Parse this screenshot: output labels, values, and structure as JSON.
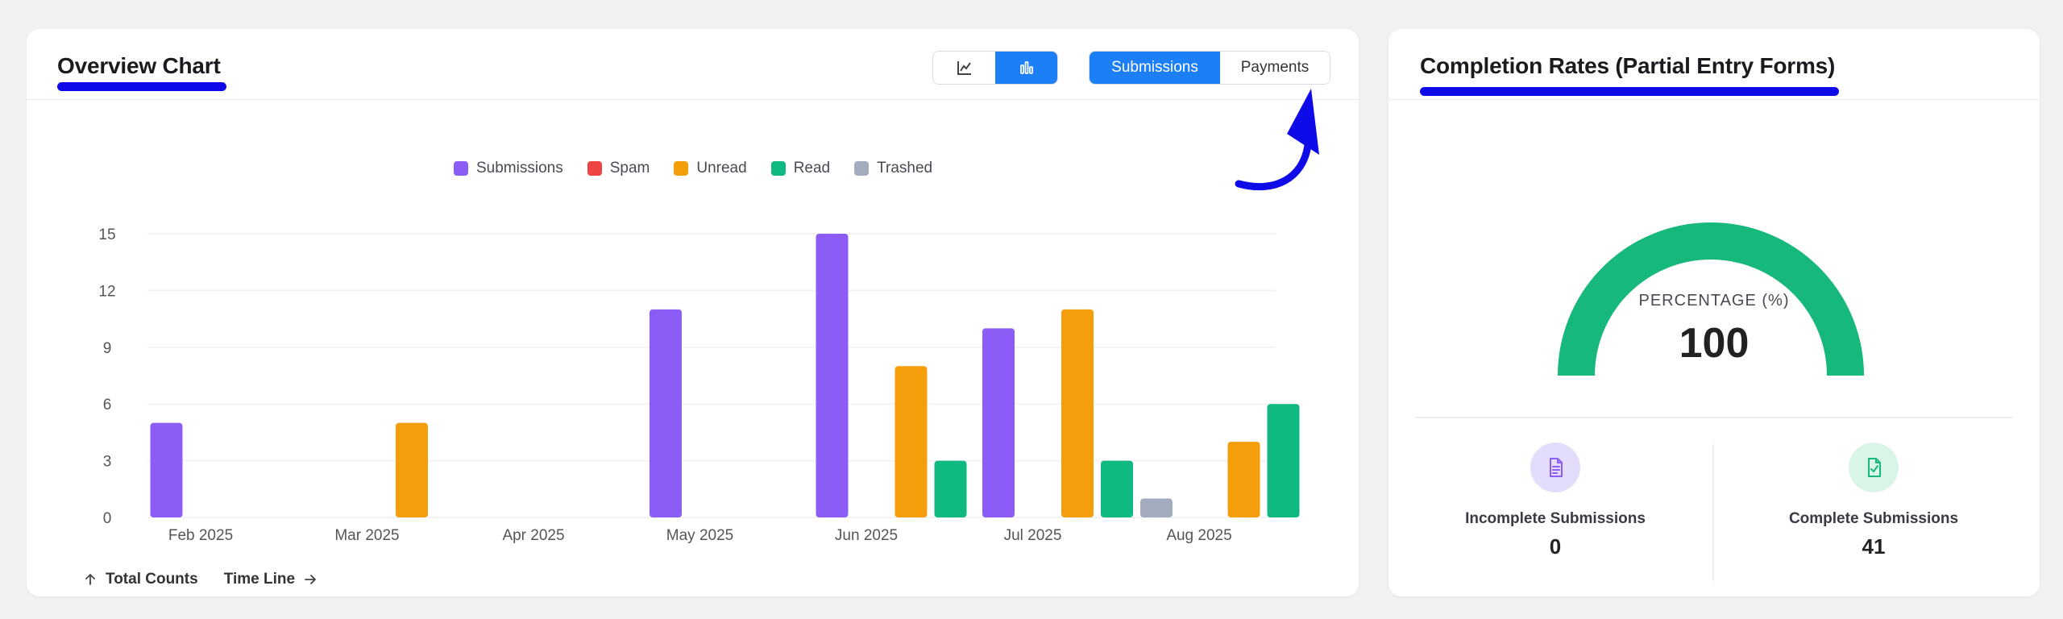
{
  "overview": {
    "title": "Overview Chart",
    "view_toggle": [
      {
        "icon": "line-chart-icon",
        "active": false
      },
      {
        "icon": "bar-chart-icon",
        "active": true
      }
    ],
    "segments": [
      {
        "label": "Submissions",
        "active": true
      },
      {
        "label": "Payments",
        "active": false
      }
    ],
    "footer": {
      "total_counts": "Total Counts",
      "time_line": "Time Line"
    }
  },
  "completion": {
    "title": "Completion Rates (Partial Entry Forms)",
    "gauge_label": "PERCENTAGE (%)",
    "gauge_value": "100",
    "gauge_fraction": 1.0,
    "incomplete": {
      "label": "Incomplete Submissions",
      "value": "0",
      "icon": "document-icon"
    },
    "complete": {
      "label": "Complete Submissions",
      "value": "41",
      "icon": "document-check-icon"
    }
  },
  "colors": {
    "accent": "#1c7ff5",
    "annotation": "#0f0ae8",
    "gauge": "#17b87b"
  },
  "chart_data": {
    "type": "bar",
    "categories": [
      "Feb 2025",
      "Mar 2025",
      "Apr 2025",
      "May 2025",
      "Jun 2025",
      "Jul 2025",
      "Aug 2025"
    ],
    "yticks": [
      "0",
      "3",
      "6",
      "9",
      "12",
      "15"
    ],
    "ylim": [
      0,
      15
    ],
    "grid": true,
    "legend_position": "top-center",
    "series": [
      {
        "name": "Submissions",
        "color": "#8b5cf6",
        "values": [
          5,
          0,
          0,
          11,
          15,
          10,
          0
        ]
      },
      {
        "name": "Spam",
        "color": "#ef4444",
        "values": [
          0,
          0,
          0,
          0,
          0,
          0,
          0
        ]
      },
      {
        "name": "Unread",
        "color": "#f59e0b",
        "values": [
          0,
          5,
          0,
          0,
          8,
          11,
          4
        ]
      },
      {
        "name": "Read",
        "color": "#10b981",
        "values": [
          0,
          0,
          0,
          0,
          3,
          3,
          6
        ]
      },
      {
        "name": "Trashed",
        "color": "#a3acbf",
        "values": [
          0,
          0,
          0,
          0,
          0,
          1,
          0
        ]
      }
    ]
  }
}
